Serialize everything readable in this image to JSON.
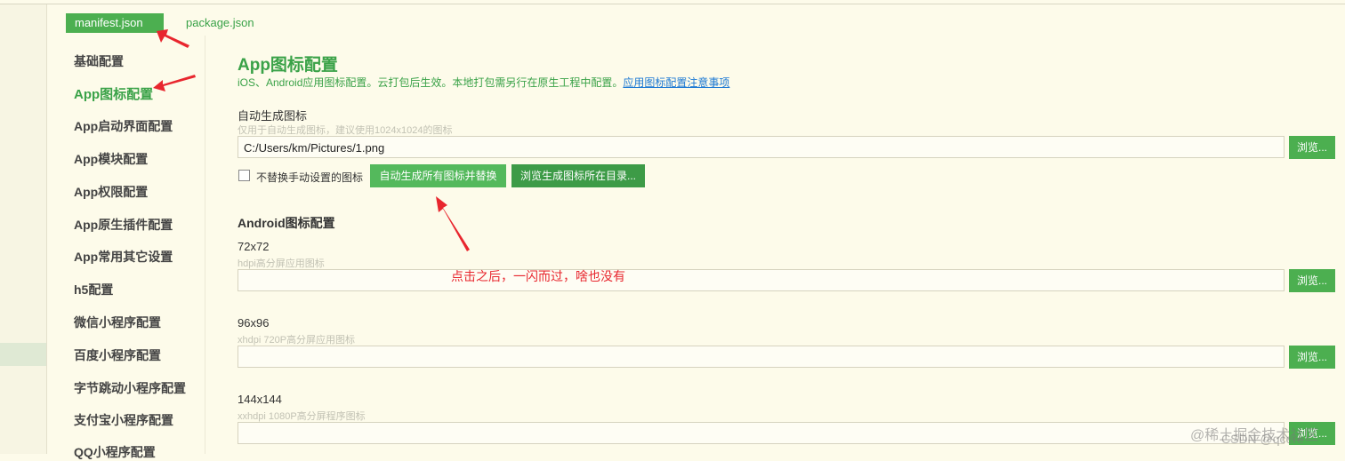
{
  "tabs": {
    "active": "manifest.json",
    "inactive": "package.json"
  },
  "sidebar": {
    "items": [
      {
        "label": "基础配置"
      },
      {
        "label": "App图标配置"
      },
      {
        "label": "App启动界面配置"
      },
      {
        "label": "App模块配置"
      },
      {
        "label": "App权限配置"
      },
      {
        "label": "App原生插件配置"
      },
      {
        "label": "App常用其它设置"
      },
      {
        "label": "h5配置"
      },
      {
        "label": "微信小程序配置"
      },
      {
        "label": "百度小程序配置"
      },
      {
        "label": "字节跳动小程序配置"
      },
      {
        "label": "支付宝小程序配置"
      },
      {
        "label": "QQ小程序配置"
      }
    ]
  },
  "main": {
    "title": "App图标配置",
    "description": "iOS、Android应用图标配置。云打包后生效。本地打包需另行在原生工程中配置。",
    "description_link": "应用图标配置注意事项",
    "auto": {
      "label": "自动生成图标",
      "hint": "仅用于自动生成图标，建议使用1024x1024的图标",
      "value": "C:/Users/km/Pictures/1.png",
      "browse": "浏览...",
      "checkbox_label": "不替换手动设置的图标",
      "generate_button": "自动生成所有图标并替换",
      "open_dir_button": "浏览生成图标所在目录..."
    },
    "android": {
      "title": "Android图标配置",
      "fields": [
        {
          "label": "72x72",
          "hint": "hdpi高分屏应用图标",
          "value": "",
          "browse": "浏览..."
        },
        {
          "label": "96x96",
          "hint": "xhdpi 720P高分屏应用图标",
          "value": "",
          "browse": "浏览..."
        },
        {
          "label": "144x144",
          "hint": "xxhdpi 1080P高分屏程序图标",
          "value": "",
          "browse": "浏览..."
        }
      ]
    }
  },
  "annotation": {
    "note": "点击之后，一闪而过，啥也没有",
    "color": "#e8262e"
  },
  "watermarks": {
    "juejin": "@稀土掘金技术社区",
    "csdn": "CSDN @qcere"
  }
}
